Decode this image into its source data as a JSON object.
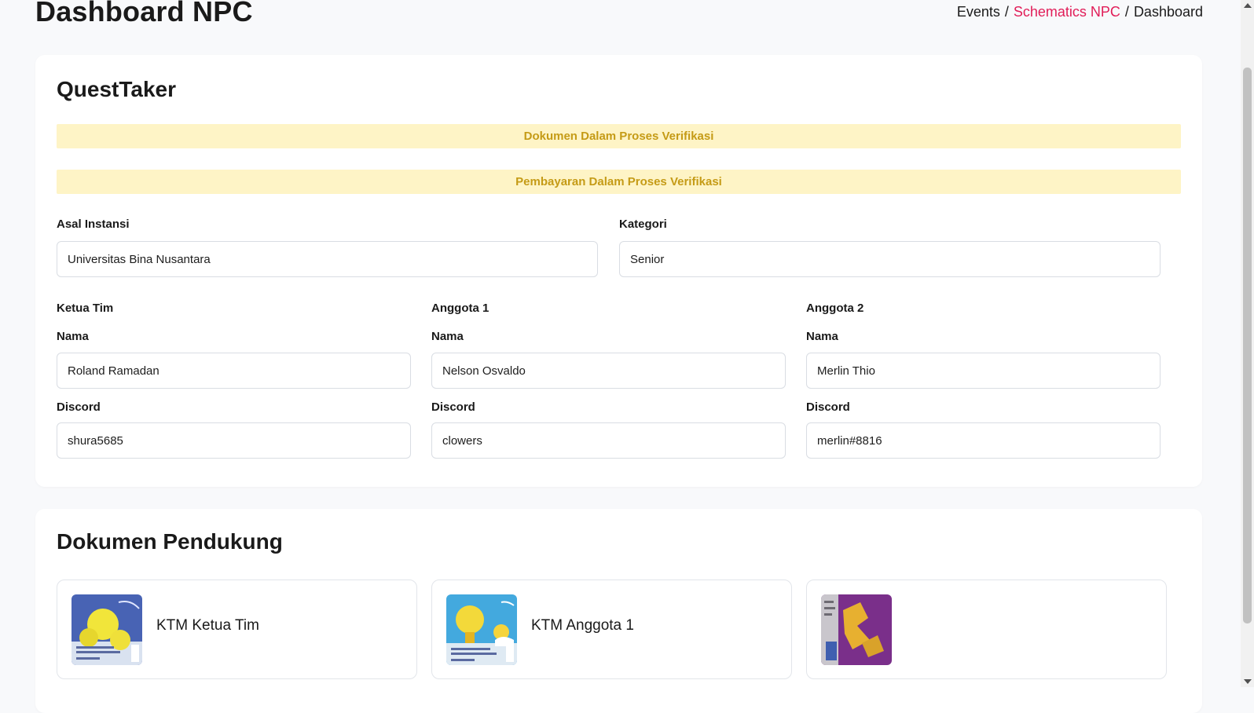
{
  "header": {
    "title": "Dashboard NPC",
    "breadcrumb": {
      "item1": "Events",
      "item2": "Schematics NPC",
      "item3": "Dashboard",
      "separator": "/"
    }
  },
  "team_card": {
    "title": "QuestTaker",
    "alerts": {
      "document": "Dokumen Dalam Proses Verifikasi",
      "payment": "Pembayaran Dalam Proses Verifikasi"
    },
    "institution": {
      "label": "Asal Instansi",
      "value": "Universitas Bina Nusantara"
    },
    "category": {
      "label": "Kategori",
      "value": "Senior"
    },
    "members": [
      {
        "heading": "Ketua Tim",
        "name_label": "Nama",
        "name": "Roland Ramadan",
        "discord_label": "Discord",
        "discord": "shura5685"
      },
      {
        "heading": "Anggota 1",
        "name_label": "Nama",
        "name": "Nelson Osvaldo",
        "discord_label": "Discord",
        "discord": "clowers"
      },
      {
        "heading": "Anggota 2",
        "name_label": "Nama",
        "name": "Merlin Thio",
        "discord_label": "Discord",
        "discord": "merlin#8816"
      }
    ]
  },
  "documents_card": {
    "title": "Dokumen Pendukung",
    "documents": [
      {
        "label": "KTM Ketua Tim"
      },
      {
        "label": "KTM Anggota 1"
      },
      {
        "label": ""
      }
    ]
  },
  "colors": {
    "accent": "#e11d58",
    "alert_bg": "#fef4c6",
    "alert_text": "#c59b16",
    "page_bg": "#f8f9fb"
  }
}
